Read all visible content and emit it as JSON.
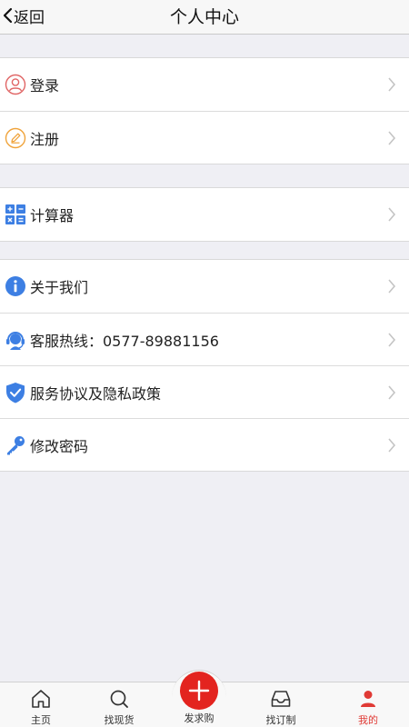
{
  "header": {
    "back_label": "返回",
    "title": "个人中心"
  },
  "groups": [
    {
      "items": [
        {
          "label": "登录",
          "icon": "user-circle-icon"
        },
        {
          "label": "注册",
          "icon": "pencil-circle-icon"
        }
      ]
    },
    {
      "items": [
        {
          "label": "计算器",
          "icon": "calculator-icon"
        }
      ]
    },
    {
      "items": [
        {
          "label": "关于我们",
          "icon": "info-icon"
        },
        {
          "label": "客服热线：0577-89881156",
          "icon": "headset-icon"
        },
        {
          "label": "服务协议及隐私政策",
          "icon": "shield-check-icon"
        },
        {
          "label": "修改密码",
          "icon": "key-icon"
        }
      ]
    }
  ],
  "tabbar": {
    "items": [
      {
        "label": "主页",
        "icon": "home-icon"
      },
      {
        "label": "找现货",
        "icon": "search-icon"
      },
      {
        "label": "发求购",
        "icon": "plus-icon"
      },
      {
        "label": "找订制",
        "icon": "inbox-icon"
      },
      {
        "label": "我的",
        "icon": "person-icon"
      }
    ],
    "active": "我的"
  },
  "colors": {
    "accent": "#e3241f",
    "icon_blue": "#3d7fe3",
    "icon_red": "#e06464",
    "icon_orange": "#f0a33a",
    "background": "#efeff4"
  }
}
